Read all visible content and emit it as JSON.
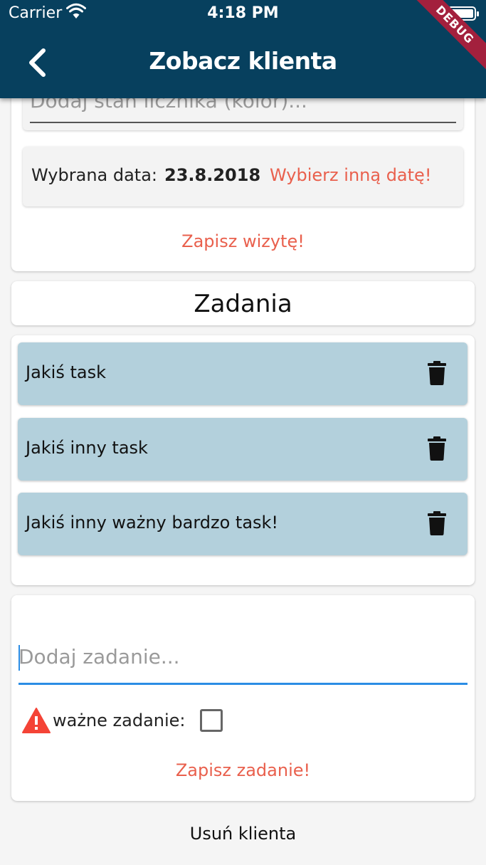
{
  "status_bar": {
    "carrier": "Carrier",
    "time": "4:18 PM"
  },
  "debug_banner": "DEBUG",
  "app_bar": {
    "title": "Zobacz klienta"
  },
  "visit_form": {
    "counter_placeholder": "Dodaj stan licznika (kolor)...",
    "date_label": "Wybrana data:",
    "date_value": "23.8.2018",
    "change_date_button": "Wybierz inną datę!",
    "save_visit_button": "Zapisz wizytę!"
  },
  "tasks_section": {
    "title": "Zadania",
    "tasks": [
      {
        "label": "Jakiś task"
      },
      {
        "label": "Jakiś inny task"
      },
      {
        "label": "Jakiś inny ważny bardzo task!"
      }
    ]
  },
  "add_task": {
    "placeholder": "Dodaj zadanie...",
    "important_label": "ważne zadanie:",
    "important_checked": false,
    "save_button": "Zapisz zadanie!"
  },
  "delete_client_button": "Usuń klienta",
  "colors": {
    "app_bar": "#07405e",
    "accent_red": "#e9604d",
    "task_bg": "#b3d0dc",
    "input_focus": "#2b8de5",
    "warning": "#f44336",
    "debug_banner": "#a3203d"
  }
}
